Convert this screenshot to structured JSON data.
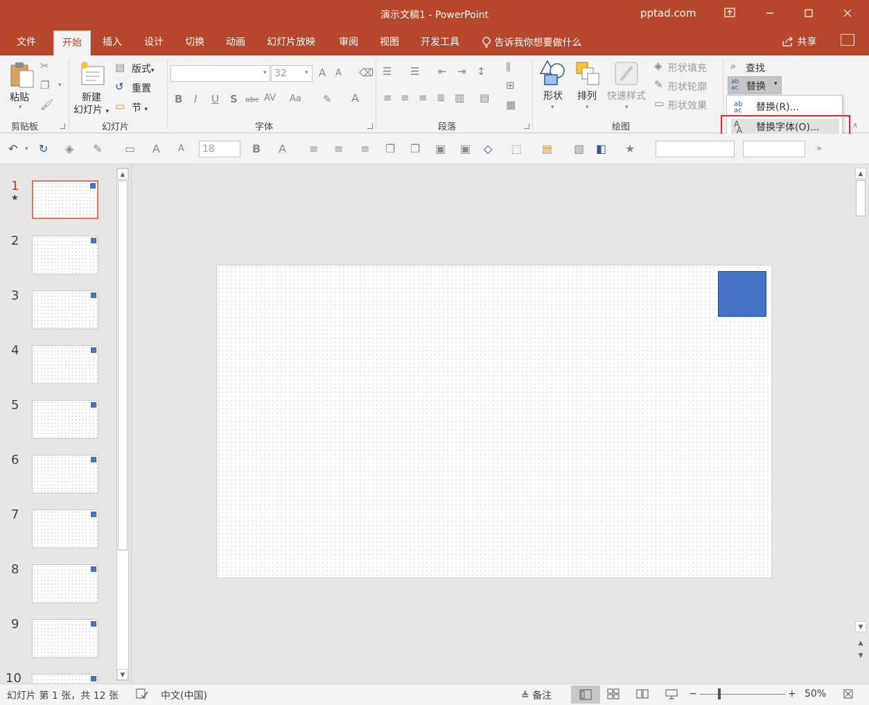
{
  "window": {
    "title": "演示文稿1  -  PowerPoint",
    "account": "pptad.com"
  },
  "tabs": [
    {
      "label": "文件"
    },
    {
      "label": "开始"
    },
    {
      "label": "插入"
    },
    {
      "label": "设计"
    },
    {
      "label": "切换"
    },
    {
      "label": "动画"
    },
    {
      "label": "幻灯片放映"
    },
    {
      "label": "审阅"
    },
    {
      "label": "视图"
    },
    {
      "label": "开发工具"
    }
  ],
  "active_tab": "开始",
  "tell_me": "告诉我你想要做什么",
  "share": "共享",
  "ribbon": {
    "clipboard": {
      "paste": "粘贴",
      "label": "剪贴板"
    },
    "slides": {
      "new_slide_1": "新建",
      "new_slide_2": "幻灯片",
      "layout": "版式",
      "reset": "重置",
      "section": "节",
      "label": "幻灯片"
    },
    "font": {
      "font_name": "",
      "font_size": "32",
      "bold": "B",
      "italic": "I",
      "underline": "U",
      "shadow": "S",
      "strike": "abc",
      "spacing": "AV",
      "case": "Aa",
      "color": "A",
      "grow": "A",
      "shrink": "A",
      "label": "字体"
    },
    "paragraph": {
      "label": "段落"
    },
    "drawing": {
      "shapes": "形状",
      "arrange": "排列",
      "quick_styles": "快速样式",
      "fill": "形状填充",
      "outline": "形状轮廓",
      "effects": "形状效果",
      "label": "绘图"
    },
    "editing": {
      "find": "查找",
      "replace": "替换",
      "replace_icon_top": "ab",
      "replace_icon_bottom": "ac"
    }
  },
  "replace_menu": {
    "items": [
      {
        "label": "替换(R)..."
      },
      {
        "label": "替换字体(O)..."
      }
    ],
    "hovered_index": 1
  },
  "qat": {
    "font_size": "18",
    "bold": "B",
    "text_a": "A",
    "more": "»"
  },
  "slides": [
    {
      "num": "1",
      "star": "★"
    },
    {
      "num": "2"
    },
    {
      "num": "3"
    },
    {
      "num": "4"
    },
    {
      "num": "5"
    },
    {
      "num": "6"
    },
    {
      "num": "7"
    },
    {
      "num": "8"
    },
    {
      "num": "9"
    },
    {
      "num": "10"
    }
  ],
  "current_slide": 1,
  "shape_color": "#4472c4",
  "accent_color": "#b7472a",
  "statusbar": {
    "slide_info": "幻灯片 第 1 张，共 12 张",
    "language": "中文(中国)",
    "notes": "备注",
    "zoom": "50%",
    "zoom_level": 0.5
  }
}
